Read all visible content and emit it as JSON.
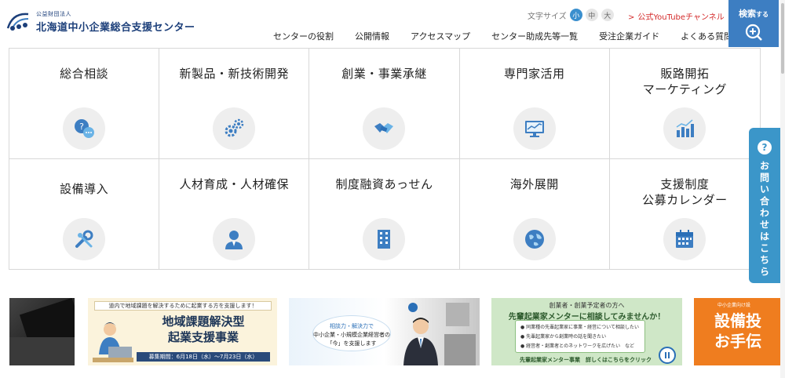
{
  "header": {
    "logo_small": "公益財団法人",
    "logo_main": "北海道中小企業総合支援センター",
    "font_size_label": "文字サイズ",
    "font_sizes": [
      "小",
      "中",
      "大"
    ],
    "youtube_link": "公式YouTubeチャンネル",
    "search_label": "検索",
    "search_suffix": "する"
  },
  "nav": [
    "センターの役割",
    "公開情報",
    "アクセスマップ",
    "センター助成先等一覧",
    "受注企業ガイド",
    "よくある質問"
  ],
  "services": [
    {
      "label": "総合相談",
      "icon": "chat-bubbles-icon"
    },
    {
      "label": "新製品・新技術開発",
      "icon": "gears-icon"
    },
    {
      "label": "創業・事業承継",
      "icon": "handshake-icon"
    },
    {
      "label": "専門家活用",
      "icon": "monitor-chart-icon"
    },
    {
      "label": "販路開拓\nマーケティング",
      "icon": "bar-chart-icon"
    },
    {
      "label": "設備導入",
      "icon": "wrench-icon"
    },
    {
      "label": "人材育成・人材確保",
      "icon": "person-icon"
    },
    {
      "label": "制度融資あっせん",
      "icon": "building-icon"
    },
    {
      "label": "海外展開",
      "icon": "globe-icon"
    },
    {
      "label": "支援制度\n公募カレンダー",
      "icon": "calendar-icon"
    }
  ],
  "side_tab": {
    "label": "お問い合わせはこちら"
  },
  "banners": {
    "b2": {
      "top": "道内で地域課題を解決するために起業する方を支援します！",
      "title": "地域課題解決型\n起業支援事業",
      "foot": "募集期間：6月18日（水）〜7月23日（水）"
    },
    "b3": {
      "line1": "相談力・解決力で",
      "line2": "中小企業・小規模企業経営者の",
      "line3": "「今」を支援します"
    },
    "b4": {
      "line1": "創業者・創業予定者の方へ",
      "line2": "先輩起業家メンターに相談してみませんか！",
      "items": [
        "同業種の先輩起業家に事業・経営について相談したい",
        "先輩起業家から創業時の話を聞きたい",
        "経営者・創業者とのネットワークを広げたい　など"
      ],
      "foot": "先輩起業家メンター事業　詳しくはこちらをクリック"
    },
    "b5": {
      "small": "中小企業向け設",
      "title": "設備投\nお手伝"
    }
  },
  "colors": {
    "brand_blue": "#1c3f7a",
    "search_bg": "#3d7ec2",
    "side_tab": "#3b96c9",
    "youtube_red": "#d42b2b"
  }
}
